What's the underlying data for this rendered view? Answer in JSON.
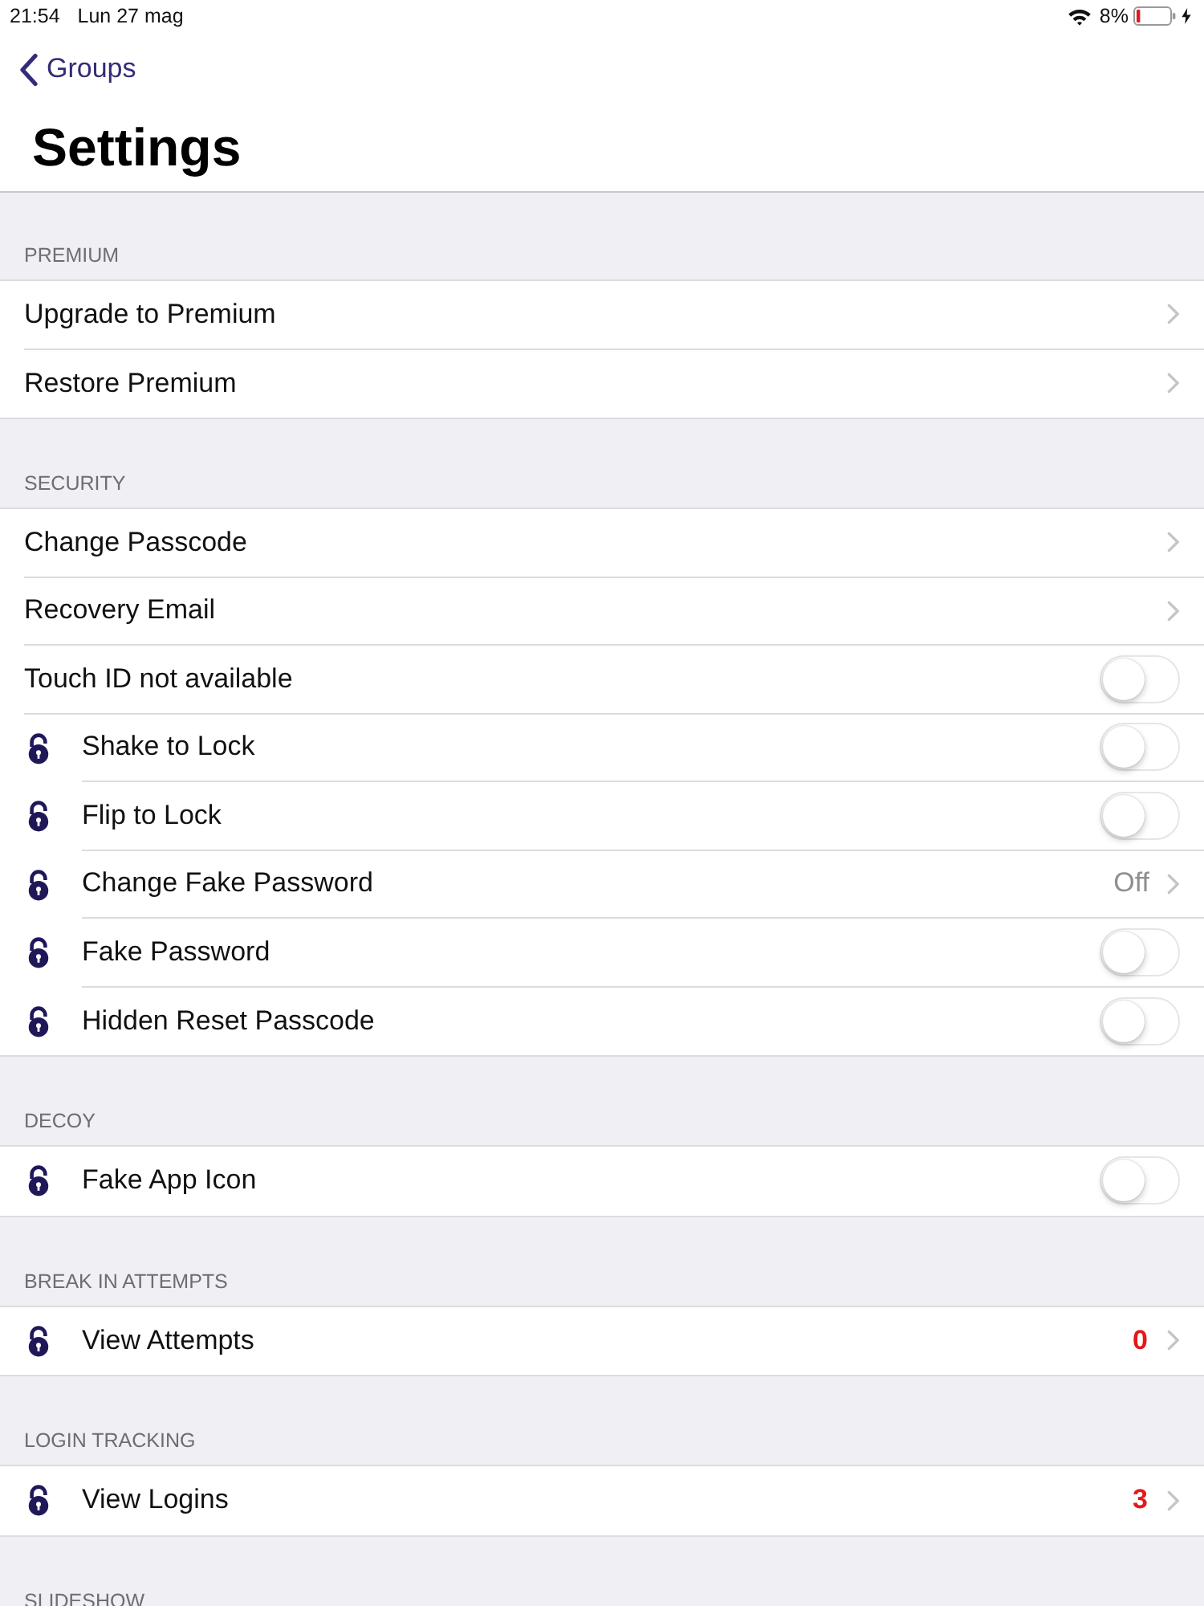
{
  "status_bar": {
    "time": "21:54",
    "date": "Lun 27 mag",
    "battery_percent": "8%"
  },
  "navigation": {
    "back_label": "Groups",
    "title": "Settings"
  },
  "sections": [
    {
      "header": "PREMIUM",
      "rows": [
        {
          "label": "Upgrade to Premium",
          "kind": "link",
          "premium_lock": false
        },
        {
          "label": "Restore Premium",
          "kind": "link",
          "premium_lock": false
        }
      ]
    },
    {
      "header": "SECURITY",
      "rows": [
        {
          "label": "Change Passcode",
          "kind": "link",
          "premium_lock": false
        },
        {
          "label": "Recovery Email",
          "kind": "link",
          "premium_lock": false
        },
        {
          "label": "Touch ID not available",
          "kind": "toggle",
          "on": false,
          "premium_lock": false
        },
        {
          "label": "Shake to Lock",
          "kind": "toggle",
          "on": false,
          "premium_lock": true
        },
        {
          "label": "Flip to Lock",
          "kind": "toggle",
          "on": false,
          "premium_lock": true
        },
        {
          "label": "Change Fake Password",
          "kind": "detail",
          "value": "Off",
          "premium_lock": true
        },
        {
          "label": "Fake Password",
          "kind": "toggle",
          "on": false,
          "premium_lock": true
        },
        {
          "label": "Hidden Reset Passcode",
          "kind": "toggle",
          "on": false,
          "premium_lock": true
        }
      ]
    },
    {
      "header": "DECOY",
      "rows": [
        {
          "label": "Fake App Icon",
          "kind": "toggle",
          "on": false,
          "premium_lock": true
        }
      ]
    },
    {
      "header": "BREAK IN ATTEMPTS",
      "rows": [
        {
          "label": "View Attempts",
          "kind": "count",
          "value": "0",
          "premium_lock": true
        }
      ]
    },
    {
      "header": "LOGIN TRACKING",
      "rows": [
        {
          "label": "View Logins",
          "kind": "count",
          "value": "3",
          "premium_lock": true
        }
      ]
    },
    {
      "header": "SLIDESHOW"
    }
  ]
}
